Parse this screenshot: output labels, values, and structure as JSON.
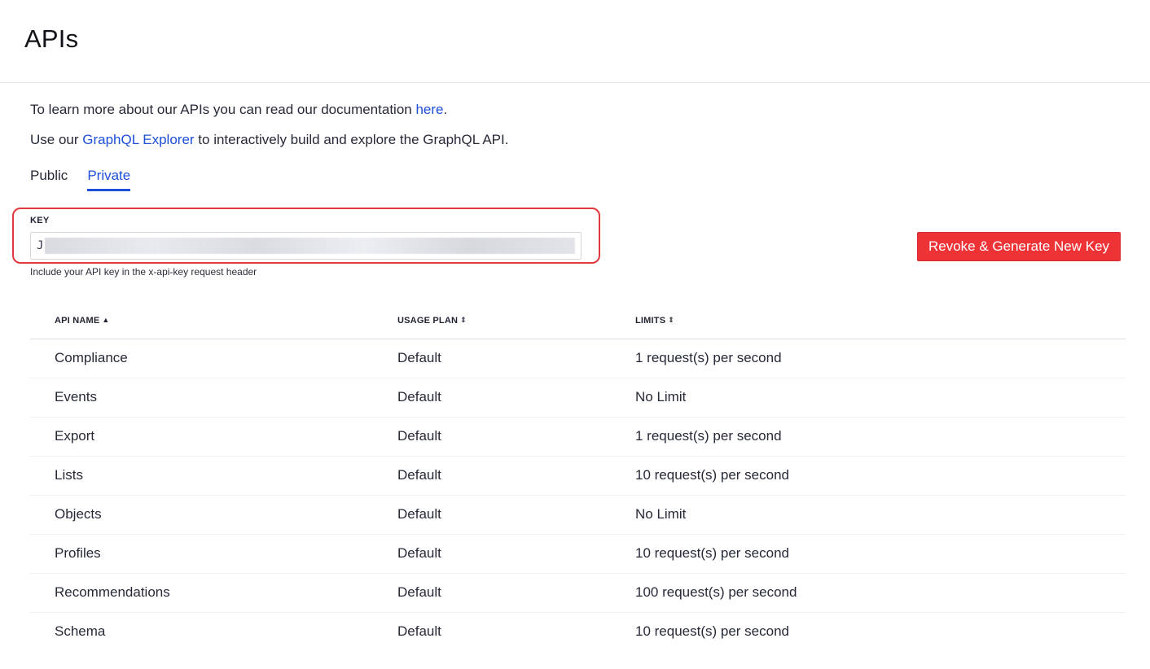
{
  "header": {
    "title": "APIs"
  },
  "intro": {
    "docs_prefix": "To learn more about our APIs you can read our documentation ",
    "docs_link": "here",
    "docs_suffix": ".",
    "explorer_prefix": "Use our ",
    "explorer_link": "GraphQL Explorer",
    "explorer_suffix": " to interactively build and explore the GraphQL API."
  },
  "tabs": [
    {
      "label": "Public",
      "active": false
    },
    {
      "label": "Private",
      "active": true
    }
  ],
  "key": {
    "label": "KEY",
    "visible_prefix": "J",
    "hint": "Include your API key in the x-api-key request header",
    "highlight_color": "#e0393e"
  },
  "actions": {
    "revoke_label": "Revoke & Generate New Key",
    "revoke_color": "#ee3337"
  },
  "table": {
    "columns": [
      {
        "label": "API NAME",
        "sort": "ascending"
      },
      {
        "label": "USAGE PLAN",
        "sort": "both"
      },
      {
        "label": "LIMITS",
        "sort": "both"
      }
    ],
    "rows": [
      {
        "name": "Compliance",
        "plan": "Default",
        "limit": "1 request(s) per second"
      },
      {
        "name": "Events",
        "plan": "Default",
        "limit": "No Limit"
      },
      {
        "name": "Export",
        "plan": "Default",
        "limit": "1 request(s) per second"
      },
      {
        "name": "Lists",
        "plan": "Default",
        "limit": "10 request(s) per second"
      },
      {
        "name": "Objects",
        "plan": "Default",
        "limit": "No Limit"
      },
      {
        "name": "Profiles",
        "plan": "Default",
        "limit": "10 request(s) per second"
      },
      {
        "name": "Recommendations",
        "plan": "Default",
        "limit": "100 request(s) per second"
      },
      {
        "name": "Schema",
        "plan": "Default",
        "limit": "10 request(s) per second"
      }
    ]
  },
  "colors": {
    "link": "#1d4fd8",
    "accent": "#1d4fd8"
  }
}
